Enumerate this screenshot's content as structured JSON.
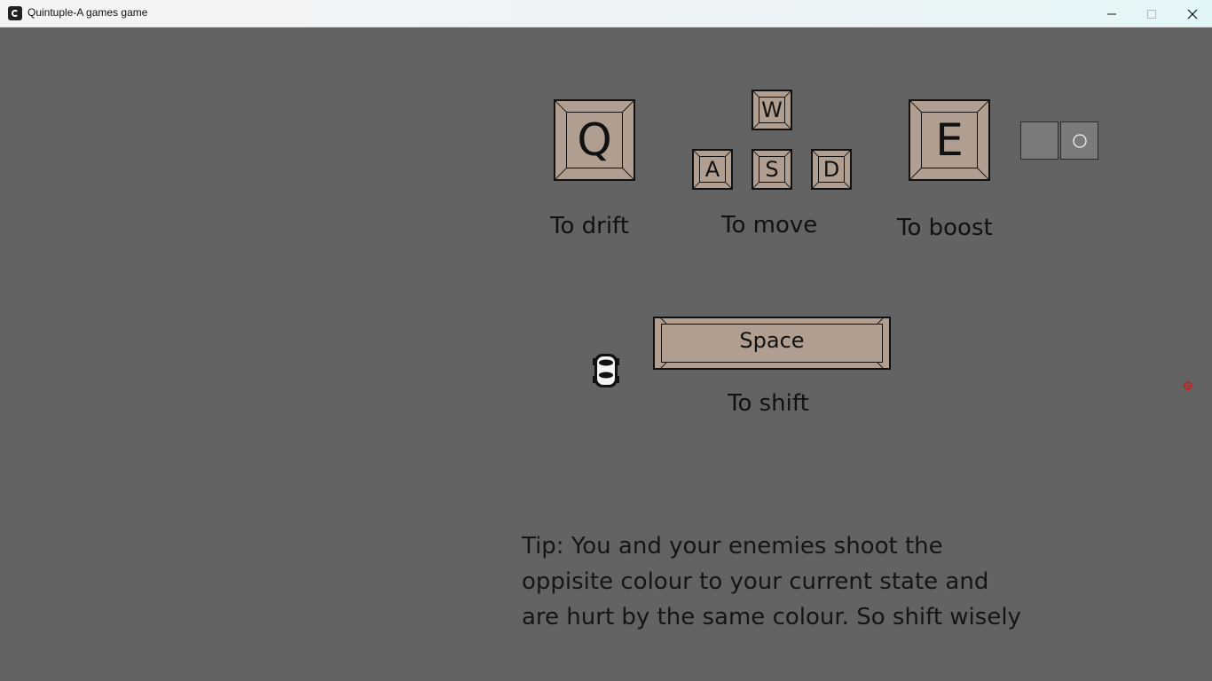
{
  "window": {
    "title": "Quintuple-A games game",
    "icon": "game-app-icon",
    "controls": [
      "minimize-icon",
      "maximize-icon",
      "close-icon"
    ]
  },
  "controls": {
    "drift": {
      "key": "Q",
      "caption": "To drift"
    },
    "move": {
      "keys": {
        "up": "W",
        "left": "A",
        "down": "S",
        "right": "D"
      },
      "caption": "To move"
    },
    "boost": {
      "key": "E",
      "caption": "To boost"
    },
    "shift": {
      "key": "Space",
      "caption": "To shift"
    }
  },
  "tip": {
    "lines": [
      "Tip: You and your enemies shoot the",
      "oppisite colour to your current state and",
      "are hurt by the same colour. So shift wisely"
    ]
  },
  "colors": {
    "background": "#636363",
    "key_face": "#b09f91",
    "text": "#111111",
    "slot": "#7b7b7b",
    "crosshair": "#cc1a1a"
  }
}
